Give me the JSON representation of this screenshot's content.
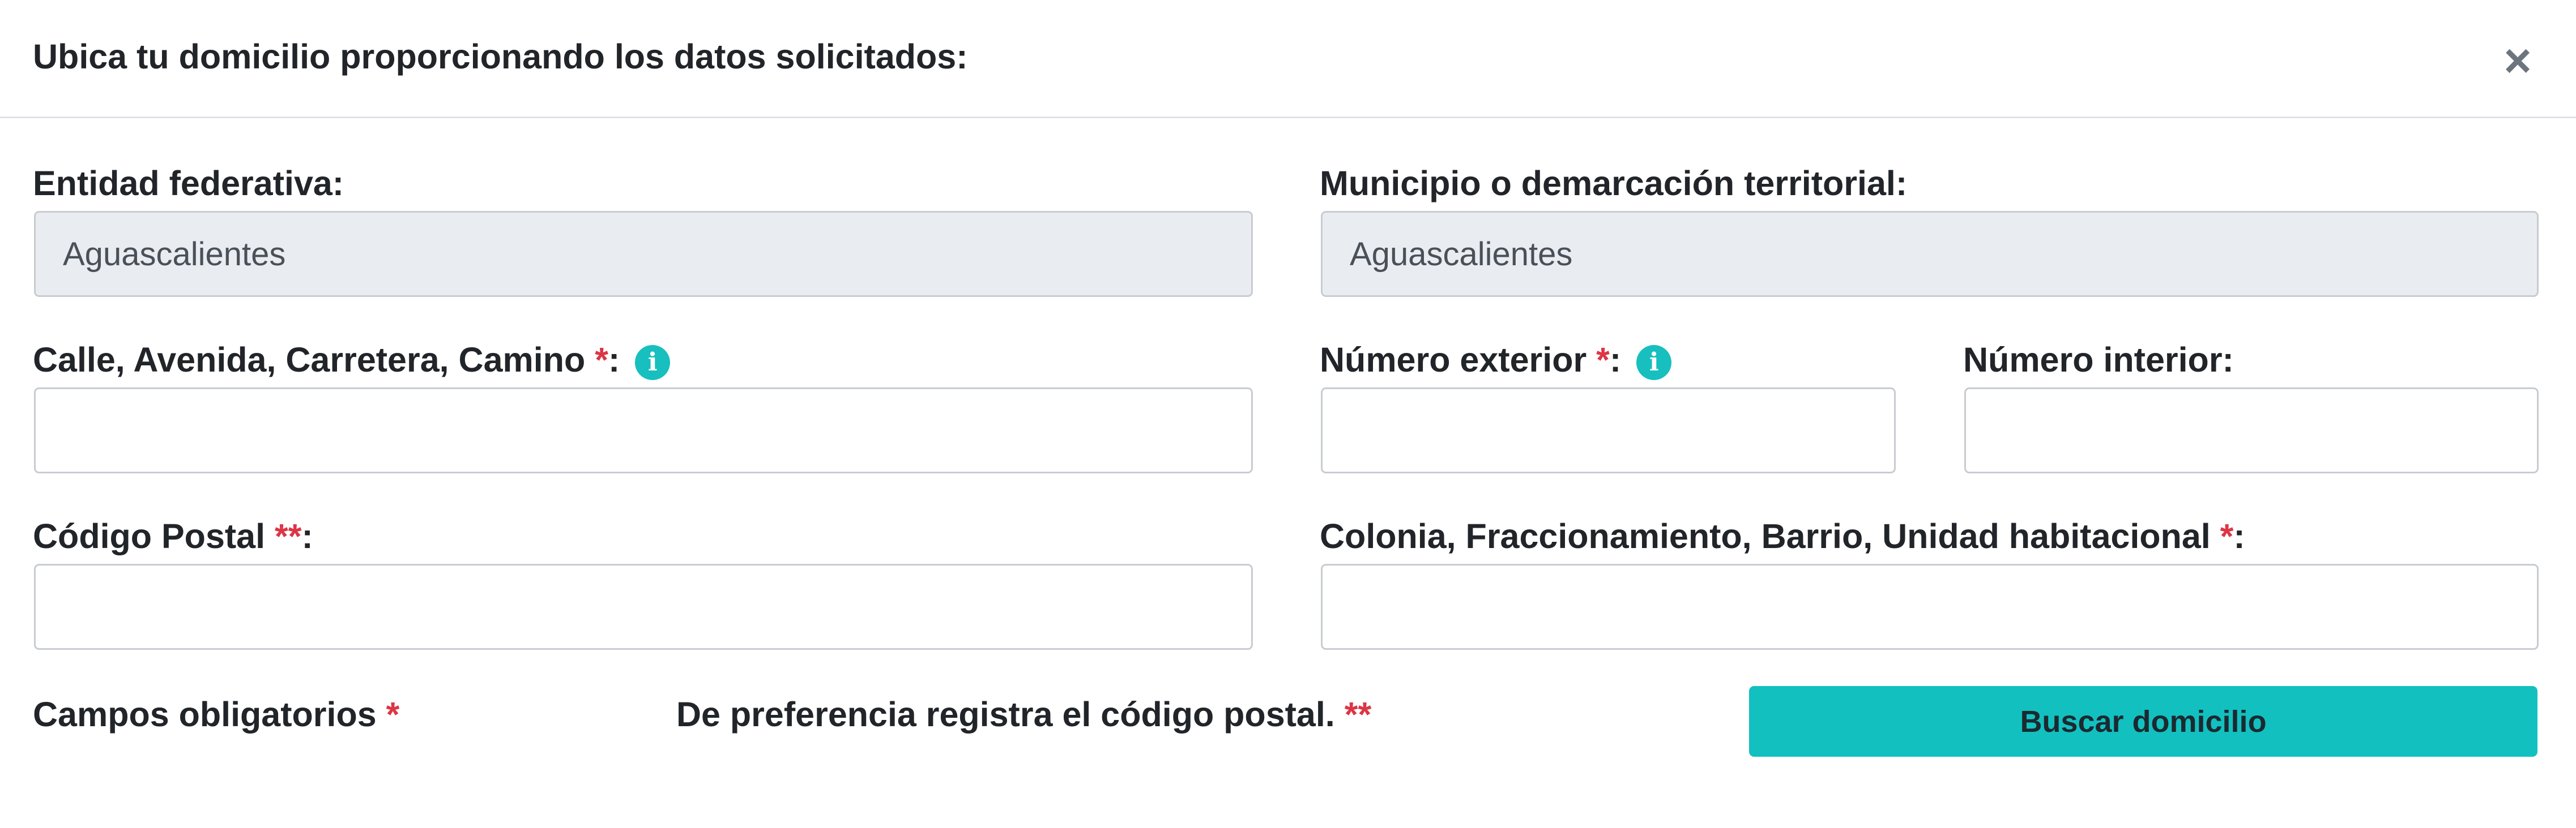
{
  "header": {
    "title": "Ubica tu domicilio proporcionando los datos solicitados:",
    "close_label": "×"
  },
  "fields": {
    "entidad": {
      "label": "Entidad federativa:",
      "value": "Aguascalientes"
    },
    "municipio": {
      "label": "Municipio o demarcación territorial:",
      "value": "Aguascalientes"
    },
    "calle": {
      "label": "Calle, Avenida, Carretera, Camino",
      "required_mark": "*",
      "suffix": ":",
      "value": ""
    },
    "numero_exterior": {
      "label": "Número exterior",
      "required_mark": "*",
      "suffix": ":",
      "value": ""
    },
    "numero_interior": {
      "label": "Número interior:",
      "value": ""
    },
    "codigo_postal": {
      "label": "Código Postal",
      "required_mark": "**",
      "suffix": ":",
      "value": ""
    },
    "colonia": {
      "label": "Colonia, Fraccionamiento, Barrio, Unidad habitacional",
      "required_mark": "*",
      "suffix": ":",
      "value": ""
    }
  },
  "footer": {
    "required_note": "Campos obligatorios",
    "required_note_mark": "*",
    "postal_note": "De preferencia registra el código postal.",
    "postal_note_mark": "**",
    "search_button": "Buscar domicilio"
  },
  "icons": {
    "info": "info-icon",
    "close": "close-icon"
  },
  "colors": {
    "accent": "#13c0c0",
    "required": "#dc3545",
    "readonly_bg": "#e9ecf1"
  }
}
